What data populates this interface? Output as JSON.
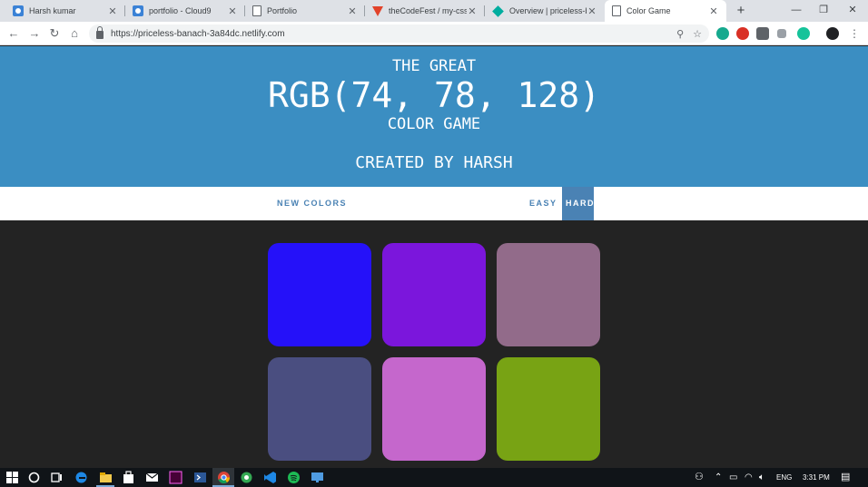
{
  "browser": {
    "tabs": [
      {
        "title": "Harsh kumar",
        "icon": "camera-favicon-icon",
        "active": false
      },
      {
        "title": "portfolio - Cloud9",
        "icon": "camera-favicon-icon",
        "active": false
      },
      {
        "title": "Portfolio",
        "icon": "document-favicon-icon",
        "active": false
      },
      {
        "title": "theCodeFest / my-css-p",
        "icon": "gitlab-fox-icon",
        "active": false
      },
      {
        "title": "Overview | priceless-ba",
        "icon": "netlify-diamond-icon",
        "active": false
      },
      {
        "title": "Color Game",
        "icon": "document-favicon-icon",
        "active": true
      }
    ],
    "new_tab_label": "+",
    "url": "https://priceless-banach-3a84dc.netlify.com"
  },
  "game": {
    "header_line1": "The Great",
    "rgb_display": "RGB(74, 78, 128)",
    "header_line3": "Color Game",
    "author": "Created by Harsh",
    "new_colors_label": "New Colors",
    "easy_label": "Easy",
    "hard_label": "Hard",
    "mode": "hard",
    "colors": {
      "header_bg": "#3b8ec2",
      "button_blue": "#4a82b4",
      "body_bg": "#232323"
    },
    "squares": [
      {
        "color": "#2511f9"
      },
      {
        "color": "#7b16dc"
      },
      {
        "color": "#926b8a"
      },
      {
        "color": "#4a4e80"
      },
      {
        "color": "#c567cc"
      },
      {
        "color": "#78a314"
      }
    ]
  },
  "taskbar": {
    "language": "ENG",
    "time": "3:31 PM"
  }
}
